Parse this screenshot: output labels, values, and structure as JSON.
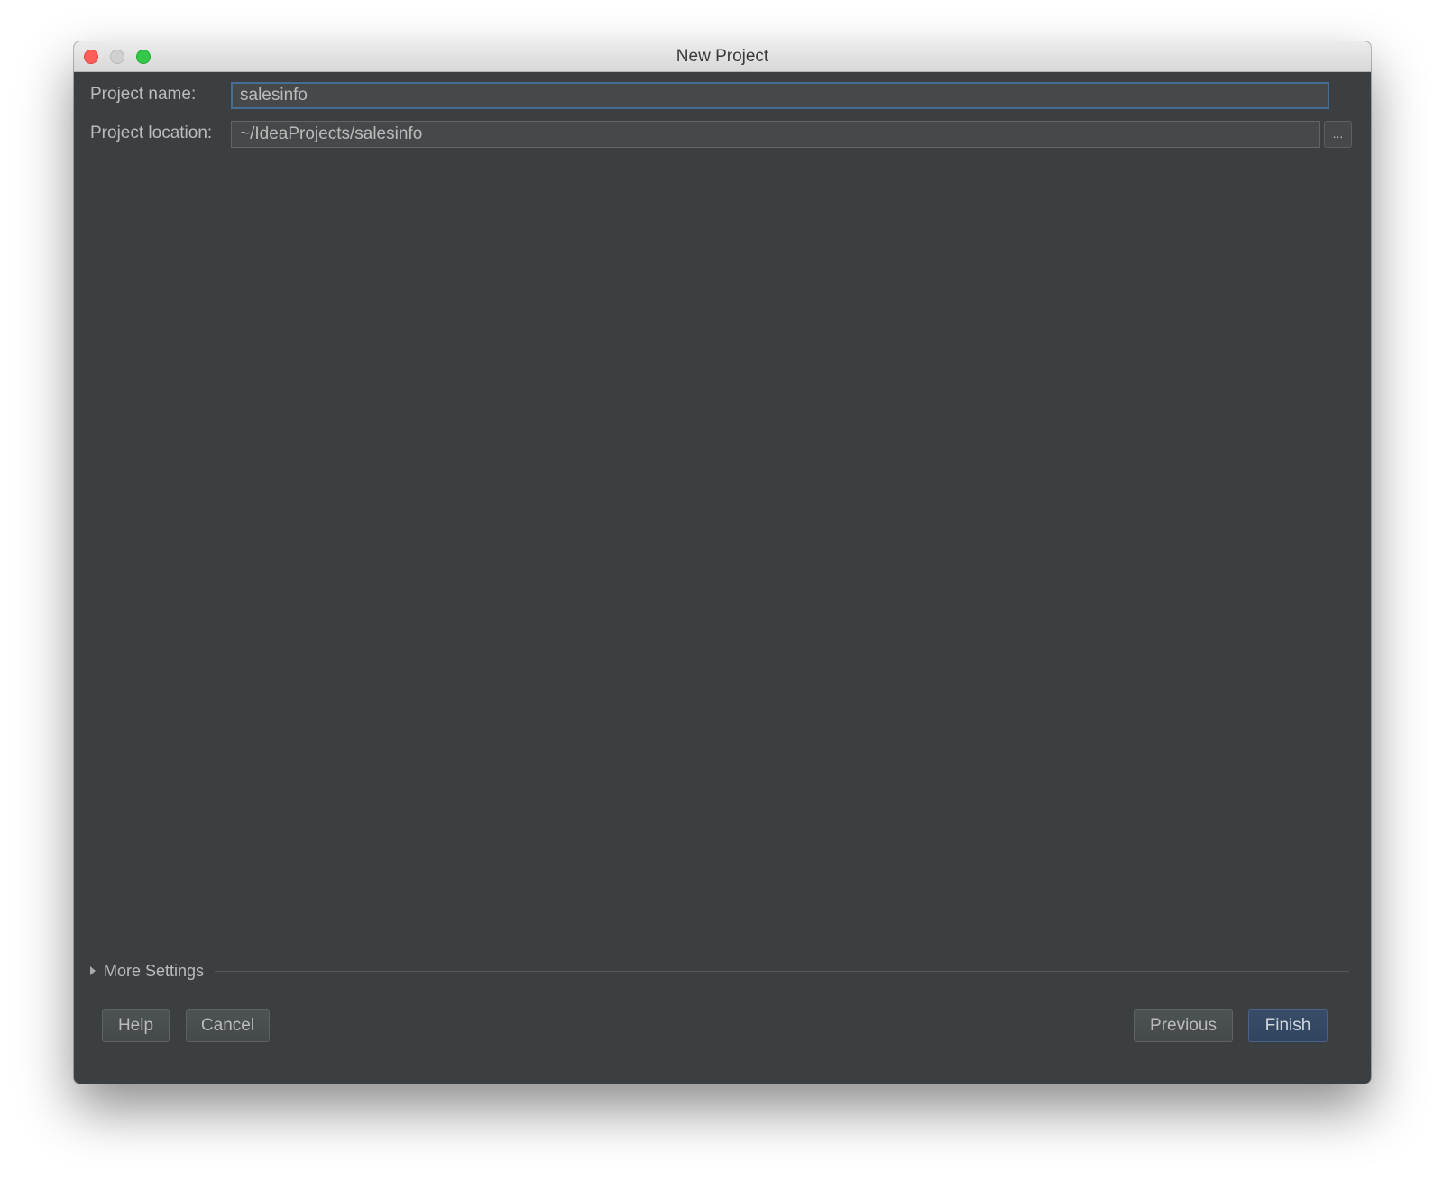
{
  "window": {
    "title": "New Project"
  },
  "form": {
    "project_name_label": "Project name:",
    "project_name_value": "salesinfo",
    "project_location_label": "Project location:",
    "project_location_value": "~/IdeaProjects/salesinfo",
    "browse_label": "..."
  },
  "more_settings": {
    "label": "More Settings",
    "expanded": false
  },
  "buttons": {
    "help": "Help",
    "cancel": "Cancel",
    "previous": "Previous",
    "finish": "Finish"
  }
}
